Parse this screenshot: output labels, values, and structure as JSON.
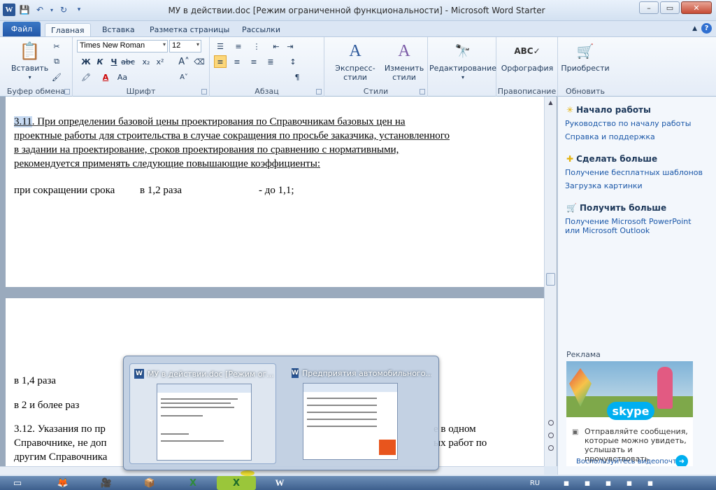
{
  "window": {
    "title": "МУ в действии.doc [Режим ограниченной функциональности]  -  Microsoft Word Starter"
  },
  "tabs": {
    "file": "Файл",
    "items": [
      "Главная",
      "Вставка",
      "Разметка страницы",
      "Рассылки"
    ]
  },
  "ribbon": {
    "clipboard": {
      "paste": "Вставить",
      "label": "Буфер обмена"
    },
    "font": {
      "name": "Times New Roman",
      "size": "12",
      "label": "Шрифт"
    },
    "paragraph": {
      "label": "Абзац"
    },
    "styles": {
      "express": "Экспресс-стили",
      "change": "Изменить стили",
      "label": "Стили"
    },
    "editing": {
      "label": "Редактирование"
    },
    "proofing": {
      "spelling": "Орфография",
      "label": "Правописание"
    },
    "update": {
      "buy": "Приобрести",
      "label": "Обновить"
    }
  },
  "document": {
    "p1_num": "3.11",
    "p1_lines": [
      ". При определении базовой цены проектирования по Справочникам базовых цен на",
      "проектные работы для строительства в случае сокращения по просьбе заказчика, установленного",
      "в задании на проектирование, сроков проектирования по сравнению с нормативными,",
      "рекомендуется применять следующие повышающие коэффициенты:"
    ],
    "p2_a": "при сокращении срока",
    "p2_b": "в 1,2 раза",
    "p2_c": "- до 1,1;",
    "p3": "в 1,4 раза",
    "p4": "в 2 и более раз",
    "p5_lines": [
      "3.12. Указания по пр",
      "Справочнике, не доп",
      "другим Справочника"
    ],
    "p5_tail1": "е в одном",
    "p5_tail2": "ых работ по"
  },
  "side": {
    "start": {
      "heading": "Начало работы",
      "links": [
        "Руководство по началу работы",
        "Справка и поддержка"
      ]
    },
    "more": {
      "heading": "Сделать больше",
      "links": [
        "Получение бесплатных шаблонов",
        "Загрузка картинки"
      ]
    },
    "get": {
      "heading": "Получить больше",
      "link": "Получение Microsoft PowerPoint или Microsoft Outlook"
    },
    "ad": {
      "label": "Реклама",
      "brand": "skype",
      "text": "Отправляйте сообщения, которые можно увидеть, услышать и прочувствовать",
      "link": "Воспользуйтесь видеопочтой"
    }
  },
  "preview": {
    "items": [
      "МУ в действии.doc [Режим ог...",
      "Предприятия автомобильного..."
    ]
  },
  "taskbar": {
    "lang": "RU"
  }
}
